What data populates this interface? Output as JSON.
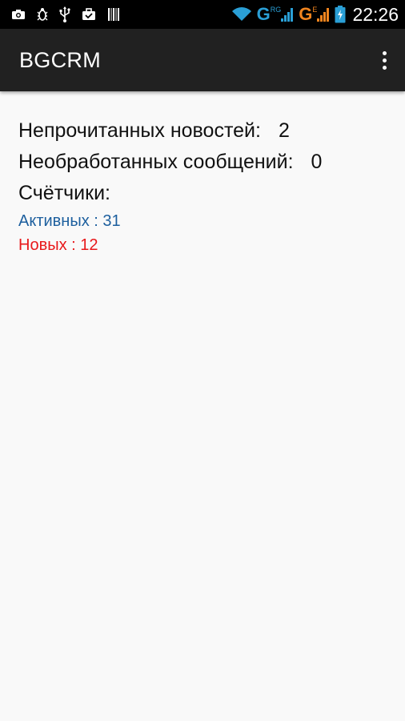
{
  "status_bar": {
    "icons_left": [
      "screenshot-icon",
      "debug-icon",
      "usb-icon",
      "briefcase-icon",
      "barcode-icon"
    ],
    "icons_right": [
      "wifi-icon",
      "sim1-signal-icon",
      "sim2-signal-icon",
      "battery-charging-icon"
    ],
    "sim1": {
      "network": "G",
      "sub": "RG"
    },
    "sim2": {
      "network": "G",
      "sub": "E"
    },
    "time": "22:26",
    "colors": {
      "wifi": "#2a9fd6",
      "sim1": "#2a9fd6",
      "sim2": "#f0841e",
      "battery": "#2a9fd6"
    }
  },
  "action_bar": {
    "title": "BGCRM",
    "menu_icon": "overflow-menu-icon"
  },
  "content": {
    "unread_news": {
      "label": "Непрочитанных новостей:",
      "value": "2"
    },
    "unprocessed_messages": {
      "label": "Необработанных сообщений:",
      "value": "0"
    },
    "counters_heading": "Счётчики:",
    "counters": [
      {
        "text": "Активных : 31",
        "color": "#1d5f9e"
      },
      {
        "text": "Новых : 12",
        "color": "#e8191b"
      }
    ]
  }
}
